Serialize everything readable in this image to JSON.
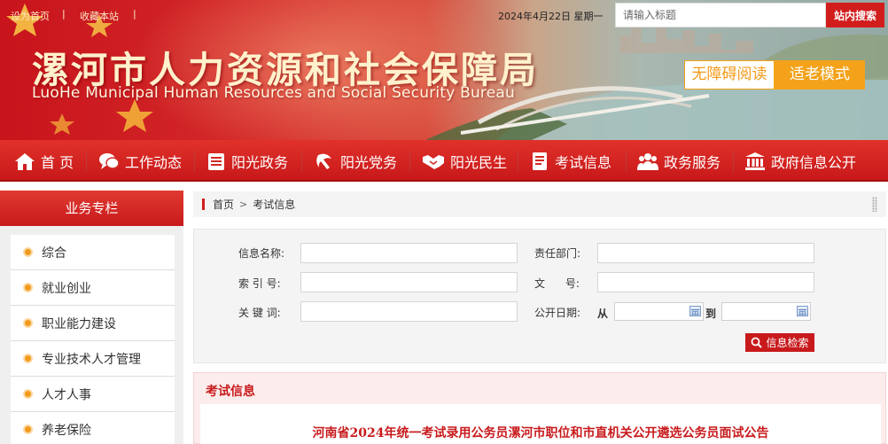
{
  "topbar": {
    "set_home": "设为首页",
    "bookmark": "收藏本站",
    "separator": "|",
    "date_text": "2024年4月22日  星期一",
    "search_placeholder": "请输入标题",
    "search_button": "站内搜索"
  },
  "header": {
    "title_cn": "漯河市人力资源和社会保障局",
    "title_en": "LuoHe Municipal Human Resources and Social Security Bureau",
    "accessibility_label": "无障碍阅读",
    "elder_mode_label": "适老模式"
  },
  "nav": {
    "items": [
      {
        "label": "首 页",
        "icon": "home-icon"
      },
      {
        "label": "工作动态",
        "icon": "chat-icon"
      },
      {
        "label": "阳光政务",
        "icon": "document-list-icon"
      },
      {
        "label": "阳光党务",
        "icon": "party-emblem-icon"
      },
      {
        "label": "阳光民生",
        "icon": "handshake-icon"
      },
      {
        "label": "考试信息",
        "icon": "exam-paper-icon"
      },
      {
        "label": "政务服务",
        "icon": "people-group-icon"
      },
      {
        "label": "政府信息公开",
        "icon": "government-building-icon"
      }
    ]
  },
  "sidebar": {
    "title": "业务专栏",
    "items": [
      {
        "label": "综合"
      },
      {
        "label": "就业创业"
      },
      {
        "label": "职业能力建设"
      },
      {
        "label": "专业技术人才管理"
      },
      {
        "label": "人才人事"
      },
      {
        "label": "养老保险"
      }
    ]
  },
  "breadcrumb": {
    "home": "首页",
    "separator": ">",
    "current": "考试信息"
  },
  "search_form": {
    "info_name_label": "信息名称:",
    "dept_label": "责任部门:",
    "index_label": "索 引 号:",
    "doc_no_label": "文      号:",
    "keyword_label": "关 键 词:",
    "publish_date_label": "公开日期:",
    "from_label": "从",
    "to_label": "到",
    "submit_label": "信息检索"
  },
  "exam_info": {
    "section_title": "考试信息",
    "notice_title": "河南省2024年统一考试录用公务员漯河市职位和市直机关公开遴选公务员面试公告"
  },
  "colors": {
    "brand_red": "#c81a1c",
    "accent_orange": "#f3a21a",
    "panel_gray": "#f4f4f4"
  }
}
